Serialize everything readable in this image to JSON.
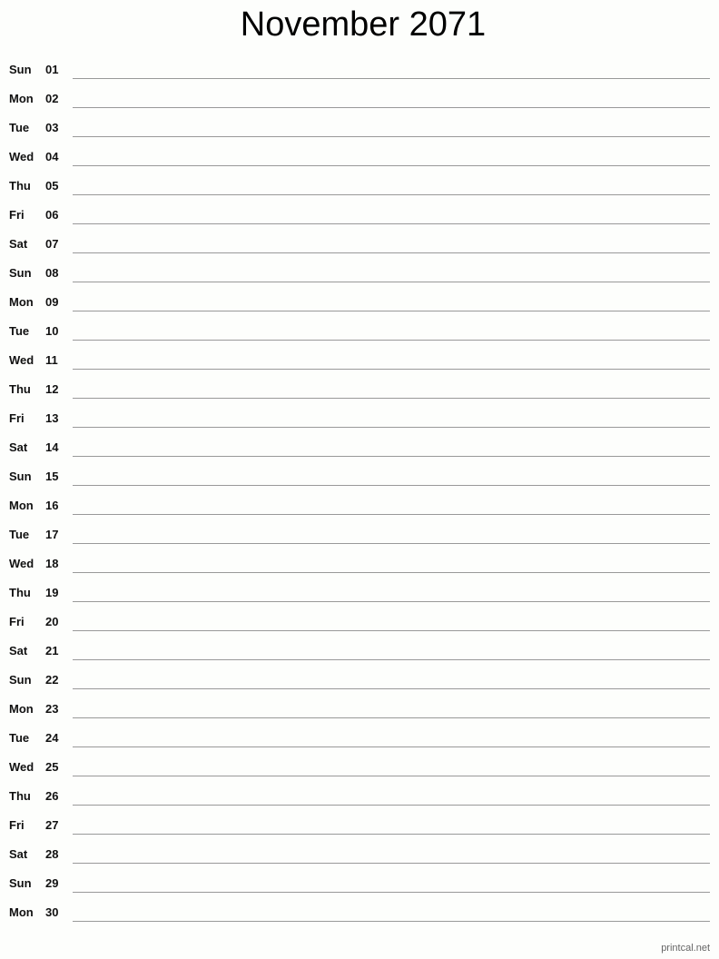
{
  "title": "November 2071",
  "days": [
    {
      "dow": "Sun",
      "num": "01"
    },
    {
      "dow": "Mon",
      "num": "02"
    },
    {
      "dow": "Tue",
      "num": "03"
    },
    {
      "dow": "Wed",
      "num": "04"
    },
    {
      "dow": "Thu",
      "num": "05"
    },
    {
      "dow": "Fri",
      "num": "06"
    },
    {
      "dow": "Sat",
      "num": "07"
    },
    {
      "dow": "Sun",
      "num": "08"
    },
    {
      "dow": "Mon",
      "num": "09"
    },
    {
      "dow": "Tue",
      "num": "10"
    },
    {
      "dow": "Wed",
      "num": "11"
    },
    {
      "dow": "Thu",
      "num": "12"
    },
    {
      "dow": "Fri",
      "num": "13"
    },
    {
      "dow": "Sat",
      "num": "14"
    },
    {
      "dow": "Sun",
      "num": "15"
    },
    {
      "dow": "Mon",
      "num": "16"
    },
    {
      "dow": "Tue",
      "num": "17"
    },
    {
      "dow": "Wed",
      "num": "18"
    },
    {
      "dow": "Thu",
      "num": "19"
    },
    {
      "dow": "Fri",
      "num": "20"
    },
    {
      "dow": "Sat",
      "num": "21"
    },
    {
      "dow": "Sun",
      "num": "22"
    },
    {
      "dow": "Mon",
      "num": "23"
    },
    {
      "dow": "Tue",
      "num": "24"
    },
    {
      "dow": "Wed",
      "num": "25"
    },
    {
      "dow": "Thu",
      "num": "26"
    },
    {
      "dow": "Fri",
      "num": "27"
    },
    {
      "dow": "Sat",
      "num": "28"
    },
    {
      "dow": "Sun",
      "num": "29"
    },
    {
      "dow": "Mon",
      "num": "30"
    }
  ],
  "footer": "printcal.net"
}
